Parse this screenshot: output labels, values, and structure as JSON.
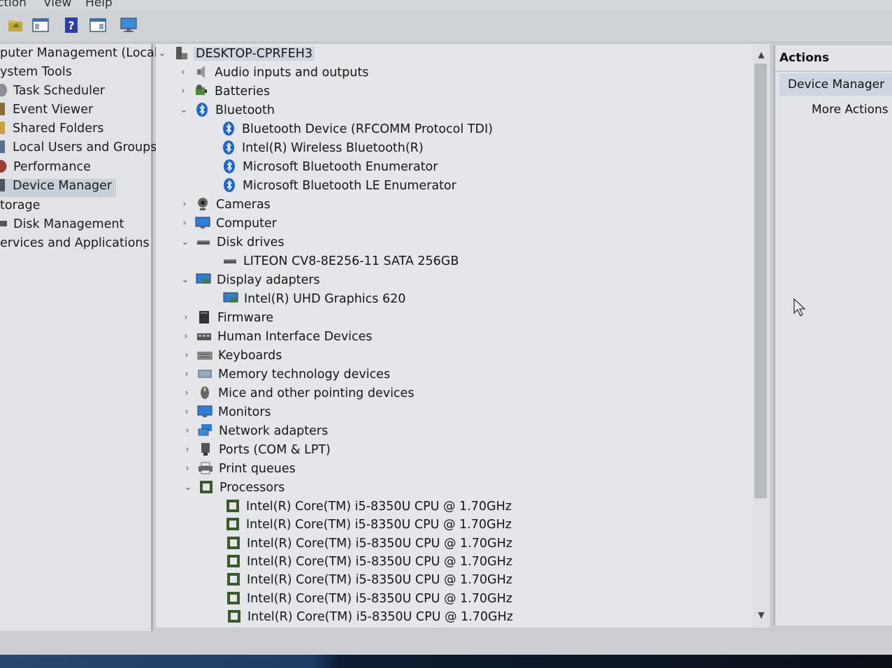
{
  "menu": {
    "items": [
      "ction",
      "View",
      "Help"
    ]
  },
  "toolbar": {
    "buttons": [
      "up-folder-icon",
      "show-hide-console-tree-icon",
      "help-icon",
      "show-hide-action-pane-icon",
      "monitor-icon"
    ]
  },
  "nav": {
    "items": [
      {
        "label": "puter Management (Local)",
        "indent": 0
      },
      {
        "label": "ystem Tools",
        "indent": 0
      },
      {
        "label": "Task Scheduler",
        "indent": 1
      },
      {
        "label": "Event Viewer",
        "indent": 1
      },
      {
        "label": "Shared Folders",
        "indent": 1
      },
      {
        "label": "Local Users and Groups",
        "indent": 1
      },
      {
        "label": "Performance",
        "indent": 1
      },
      {
        "label": "Device Manager",
        "indent": 1,
        "selected": true
      },
      {
        "label": "torage",
        "indent": 0
      },
      {
        "label": "Disk Management",
        "indent": 1
      },
      {
        "label": "ervices and Applications",
        "indent": 0
      }
    ]
  },
  "tree": {
    "root": "DESKTOP-CPRFEH3",
    "rows": [
      {
        "label": "Audio inputs and outputs",
        "expanded": false,
        "icon": "speaker"
      },
      {
        "label": "Batteries",
        "expanded": false,
        "icon": "battery"
      },
      {
        "label": "Bluetooth",
        "expanded": true,
        "icon": "bluetooth"
      },
      {
        "label": "Bluetooth Device (RFCOMM Protocol TDI)",
        "child": true,
        "icon": "bluetooth"
      },
      {
        "label": "Intel(R) Wireless Bluetooth(R)",
        "child": true,
        "icon": "bluetooth"
      },
      {
        "label": "Microsoft Bluetooth Enumerator",
        "child": true,
        "icon": "bluetooth"
      },
      {
        "label": "Microsoft Bluetooth LE Enumerator",
        "child": true,
        "icon": "bluetooth"
      },
      {
        "label": "Cameras",
        "expanded": false,
        "icon": "camera"
      },
      {
        "label": "Computer",
        "expanded": false,
        "icon": "monitor"
      },
      {
        "label": "Disk drives",
        "expanded": true,
        "icon": "disk"
      },
      {
        "label": "LITEON CV8-8E256-11 SATA 256GB",
        "child": true,
        "icon": "disk"
      },
      {
        "label": "Display adapters",
        "expanded": true,
        "icon": "display"
      },
      {
        "label": "Intel(R) UHD Graphics 620",
        "child": true,
        "icon": "display"
      },
      {
        "label": "Firmware",
        "expanded": false,
        "icon": "firmware"
      },
      {
        "label": "Human Interface Devices",
        "expanded": false,
        "icon": "hid"
      },
      {
        "label": "Keyboards",
        "expanded": false,
        "icon": "keyboard"
      },
      {
        "label": "Memory technology devices",
        "expanded": false,
        "icon": "memory"
      },
      {
        "label": "Mice and other pointing devices",
        "expanded": false,
        "icon": "mouse"
      },
      {
        "label": "Monitors",
        "expanded": false,
        "icon": "monitor"
      },
      {
        "label": "Network adapters",
        "expanded": false,
        "icon": "network"
      },
      {
        "label": "Ports (COM & LPT)",
        "expanded": false,
        "icon": "port"
      },
      {
        "label": "Print queues",
        "expanded": false,
        "icon": "printer"
      },
      {
        "label": "Processors",
        "expanded": true,
        "icon": "cpu"
      },
      {
        "label": "Intel(R) Core(TM) i5-8350U CPU @ 1.70GHz",
        "child": true,
        "icon": "cpu"
      },
      {
        "label": "Intel(R) Core(TM) i5-8350U CPU @ 1.70GHz",
        "child": true,
        "icon": "cpu"
      },
      {
        "label": "Intel(R) Core(TM) i5-8350U CPU @ 1.70GHz",
        "child": true,
        "icon": "cpu"
      },
      {
        "label": "Intel(R) Core(TM) i5-8350U CPU @ 1.70GHz",
        "child": true,
        "icon": "cpu"
      },
      {
        "label": "Intel(R) Core(TM) i5-8350U CPU @ 1.70GHz",
        "child": true,
        "icon": "cpu"
      },
      {
        "label": "Intel(R) Core(TM) i5-8350U CPU @ 1.70GHz",
        "child": true,
        "icon": "cpu"
      },
      {
        "label": "Intel(R) Core(TM) i5-8350U CPU @ 1.70GHz",
        "child": true,
        "icon": "cpu"
      }
    ]
  },
  "actions": {
    "header": "Actions",
    "section": "Device Manager",
    "more": "More Actions"
  },
  "colors": {
    "bluetooth": "#1c63d6",
    "selection": "#c8d0da",
    "display_blue": "#2f7fd8"
  }
}
